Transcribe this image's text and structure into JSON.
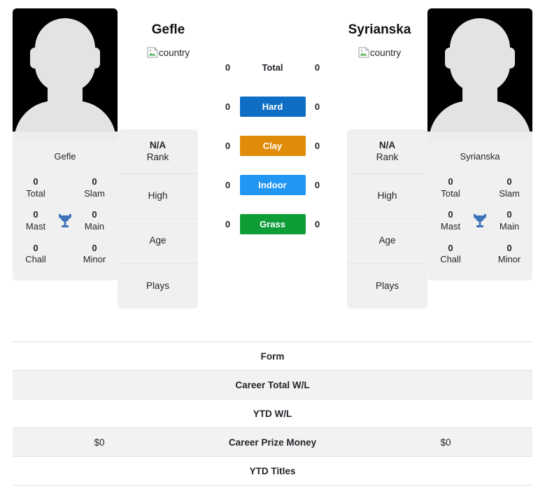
{
  "players": {
    "left": {
      "name": "Gefle",
      "country_alt": "country",
      "card_name": "Gefle",
      "titles": [
        {
          "value": "0",
          "label": "Total"
        },
        {
          "value": "0",
          "label": "Slam"
        },
        {
          "value": "0",
          "label": "Mast"
        },
        {
          "value": "0",
          "label": "Main"
        },
        {
          "value": "0",
          "label": "Chall"
        },
        {
          "value": "0",
          "label": "Minor"
        }
      ],
      "info": [
        {
          "value": "N/A",
          "label": "Rank"
        },
        {
          "value": "",
          "label": "High"
        },
        {
          "value": "",
          "label": "Age"
        },
        {
          "value": "",
          "label": "Plays"
        }
      ]
    },
    "right": {
      "name": "Syrianska",
      "country_alt": "country",
      "card_name": "Syrianska",
      "titles": [
        {
          "value": "0",
          "label": "Total"
        },
        {
          "value": "0",
          "label": "Slam"
        },
        {
          "value": "0",
          "label": "Mast"
        },
        {
          "value": "0",
          "label": "Main"
        },
        {
          "value": "0",
          "label": "Chall"
        },
        {
          "value": "0",
          "label": "Minor"
        }
      ],
      "info": [
        {
          "value": "N/A",
          "label": "Rank"
        },
        {
          "value": "",
          "label": "High"
        },
        {
          "value": "",
          "label": "Age"
        },
        {
          "value": "",
          "label": "Plays"
        }
      ]
    }
  },
  "surfaces": [
    {
      "label": "Total",
      "left": "0",
      "right": "0",
      "color": "transparent"
    },
    {
      "label": "Hard",
      "left": "0",
      "right": "0",
      "color": "#0d6ec4"
    },
    {
      "label": "Clay",
      "left": "0",
      "right": "0",
      "color": "#e08c0a"
    },
    {
      "label": "Indoor",
      "left": "0",
      "right": "0",
      "color": "#2196f3"
    },
    {
      "label": "Grass",
      "left": "0",
      "right": "0",
      "color": "#0f9d38"
    }
  ],
  "table": [
    {
      "left": "",
      "label": "Form",
      "right": "",
      "striped": false
    },
    {
      "left": "",
      "label": "Career Total W/L",
      "right": "",
      "striped": true
    },
    {
      "left": "",
      "label": "YTD W/L",
      "right": "",
      "striped": false
    },
    {
      "left": "$0",
      "label": "Career Prize Money",
      "right": "$0",
      "striped": true
    },
    {
      "left": "",
      "label": "YTD Titles",
      "right": "",
      "striped": false
    }
  ],
  "colors": {
    "hard": "#0d6ec4",
    "clay": "#e08c0a",
    "indoor": "#2196f3",
    "grass": "#0f9d38",
    "trophy": "#3d74b8",
    "card_bg": "#f0f0f0",
    "stripe_bg": "#f2f2f2"
  }
}
